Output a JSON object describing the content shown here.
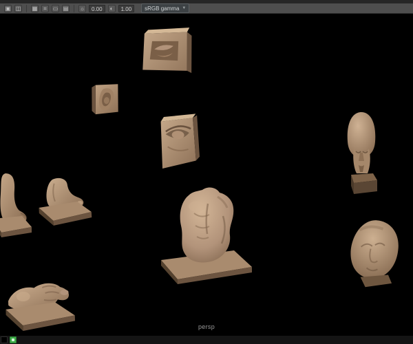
{
  "toolbar": {
    "exposure_value": "0.00",
    "gamma_value": "1.00",
    "view_transform": "sRGB gamma"
  },
  "viewport": {
    "camera_label": "persp"
  },
  "sculpts": {
    "lips_plaque": "lips-relief-plaque",
    "ear_study": "ear-study",
    "eye_plaque": "eye-relief-plaque",
    "pharaoh_head": "pharaoh-head-bust",
    "leg_foot": "leg-and-foot-study",
    "foot": "foot-on-plinth",
    "torso": "male-torso-on-plinth",
    "head_bust": "head-bust",
    "hand": "hand-on-plinth"
  },
  "colors": {
    "clay": "#b2937a",
    "clay_dark": "#73593f",
    "background": "#000000",
    "toolbar_bg": "#4e4e4e",
    "taskbar_green": "#3fae49"
  }
}
